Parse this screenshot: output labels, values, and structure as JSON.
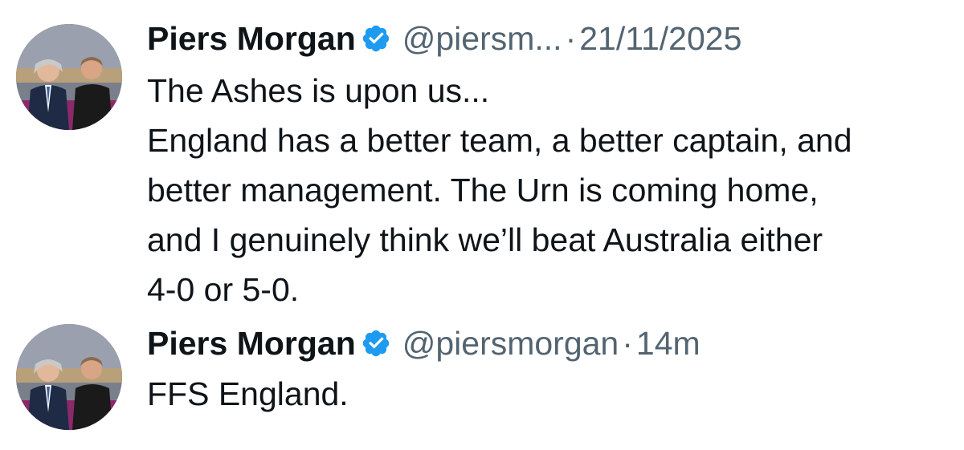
{
  "tweets": [
    {
      "author_name": "Piers Morgan",
      "handle": "@piersm...",
      "separator": "·",
      "timestamp": "21/11/2025",
      "verified": true,
      "avatar_icon": "profile-photo",
      "body_lines": [
        "The Ashes is upon us...",
        "England has a better team, a better captain, and",
        "better management. The Urn is coming home,",
        "and I genuinely think we’ll beat Australia either",
        "4-0 or 5-0."
      ]
    },
    {
      "author_name": "Piers Morgan",
      "handle": "@piersmorgan",
      "separator": "·",
      "timestamp": "14m",
      "verified": true,
      "avatar_icon": "profile-photo",
      "body_lines": [
        "FFS England."
      ]
    }
  ],
  "colors": {
    "text_primary": "#0f1419",
    "text_secondary": "#536471",
    "verified_badge": "#1d9bf0",
    "background": "#ffffff"
  }
}
